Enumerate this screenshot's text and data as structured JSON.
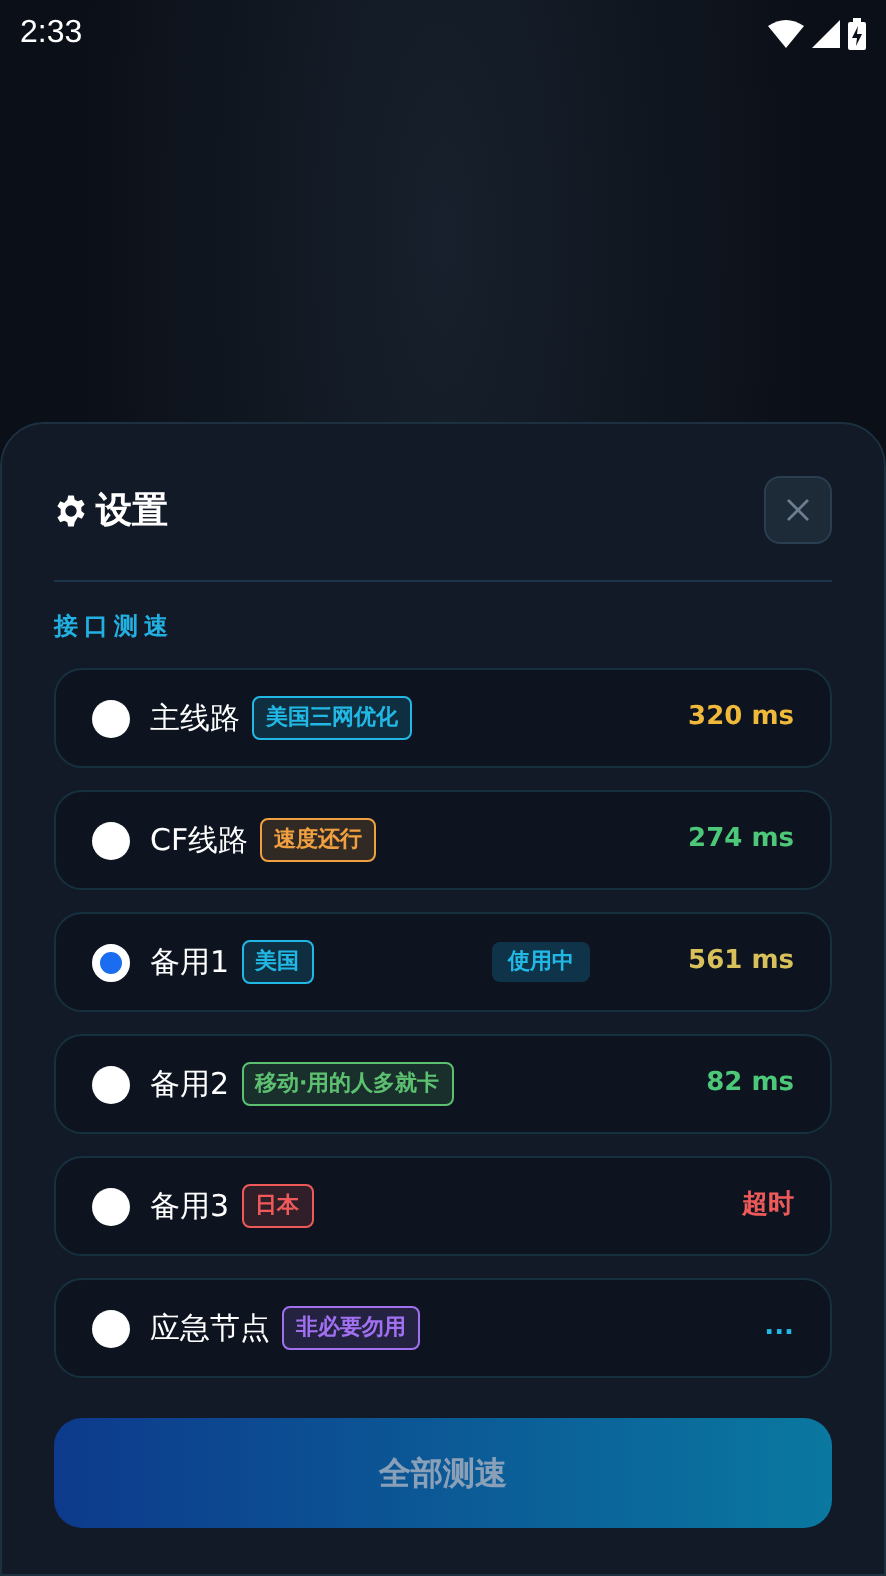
{
  "status_bar": {
    "time": "2:33"
  },
  "sheet": {
    "title": "设置",
    "section_label": "接口测速",
    "routes": [
      {
        "name": "主线路",
        "tag": {
          "text": "美国三网优化",
          "color": "#22b8e6"
        },
        "selected": false,
        "in_use": false,
        "latency": {
          "text": "320 ms",
          "color": "#f0b93a"
        }
      },
      {
        "name": "CF线路",
        "tag": {
          "text": "速度还行",
          "color": "#f0a040"
        },
        "selected": false,
        "in_use": false,
        "latency": {
          "text": "274 ms",
          "color": "#4cc878"
        }
      },
      {
        "name": "备用1",
        "tag": {
          "text": "美国",
          "color": "#22b8e6"
        },
        "selected": true,
        "in_use": true,
        "in_use_label": "使用中",
        "latency": {
          "text": "561 ms",
          "color": "#d8c05a"
        }
      },
      {
        "name": "备用2",
        "tag": {
          "text": "移动·用的人多就卡",
          "color": "#5cc070"
        },
        "selected": false,
        "in_use": false,
        "latency": {
          "text": "82 ms",
          "color": "#4cc878"
        }
      },
      {
        "name": "备用3",
        "tag": {
          "text": "日本",
          "color": "#ee5a5a"
        },
        "selected": false,
        "in_use": false,
        "latency": {
          "text": "超时",
          "color": "#ee5a5a"
        }
      },
      {
        "name": "应急节点",
        "tag": {
          "text": "非必要勿用",
          "color": "#a070f0"
        },
        "selected": false,
        "in_use": false,
        "latency": {
          "text": "...",
          "color": "#22b8e6"
        }
      }
    ],
    "test_all_button": "全部测速"
  }
}
